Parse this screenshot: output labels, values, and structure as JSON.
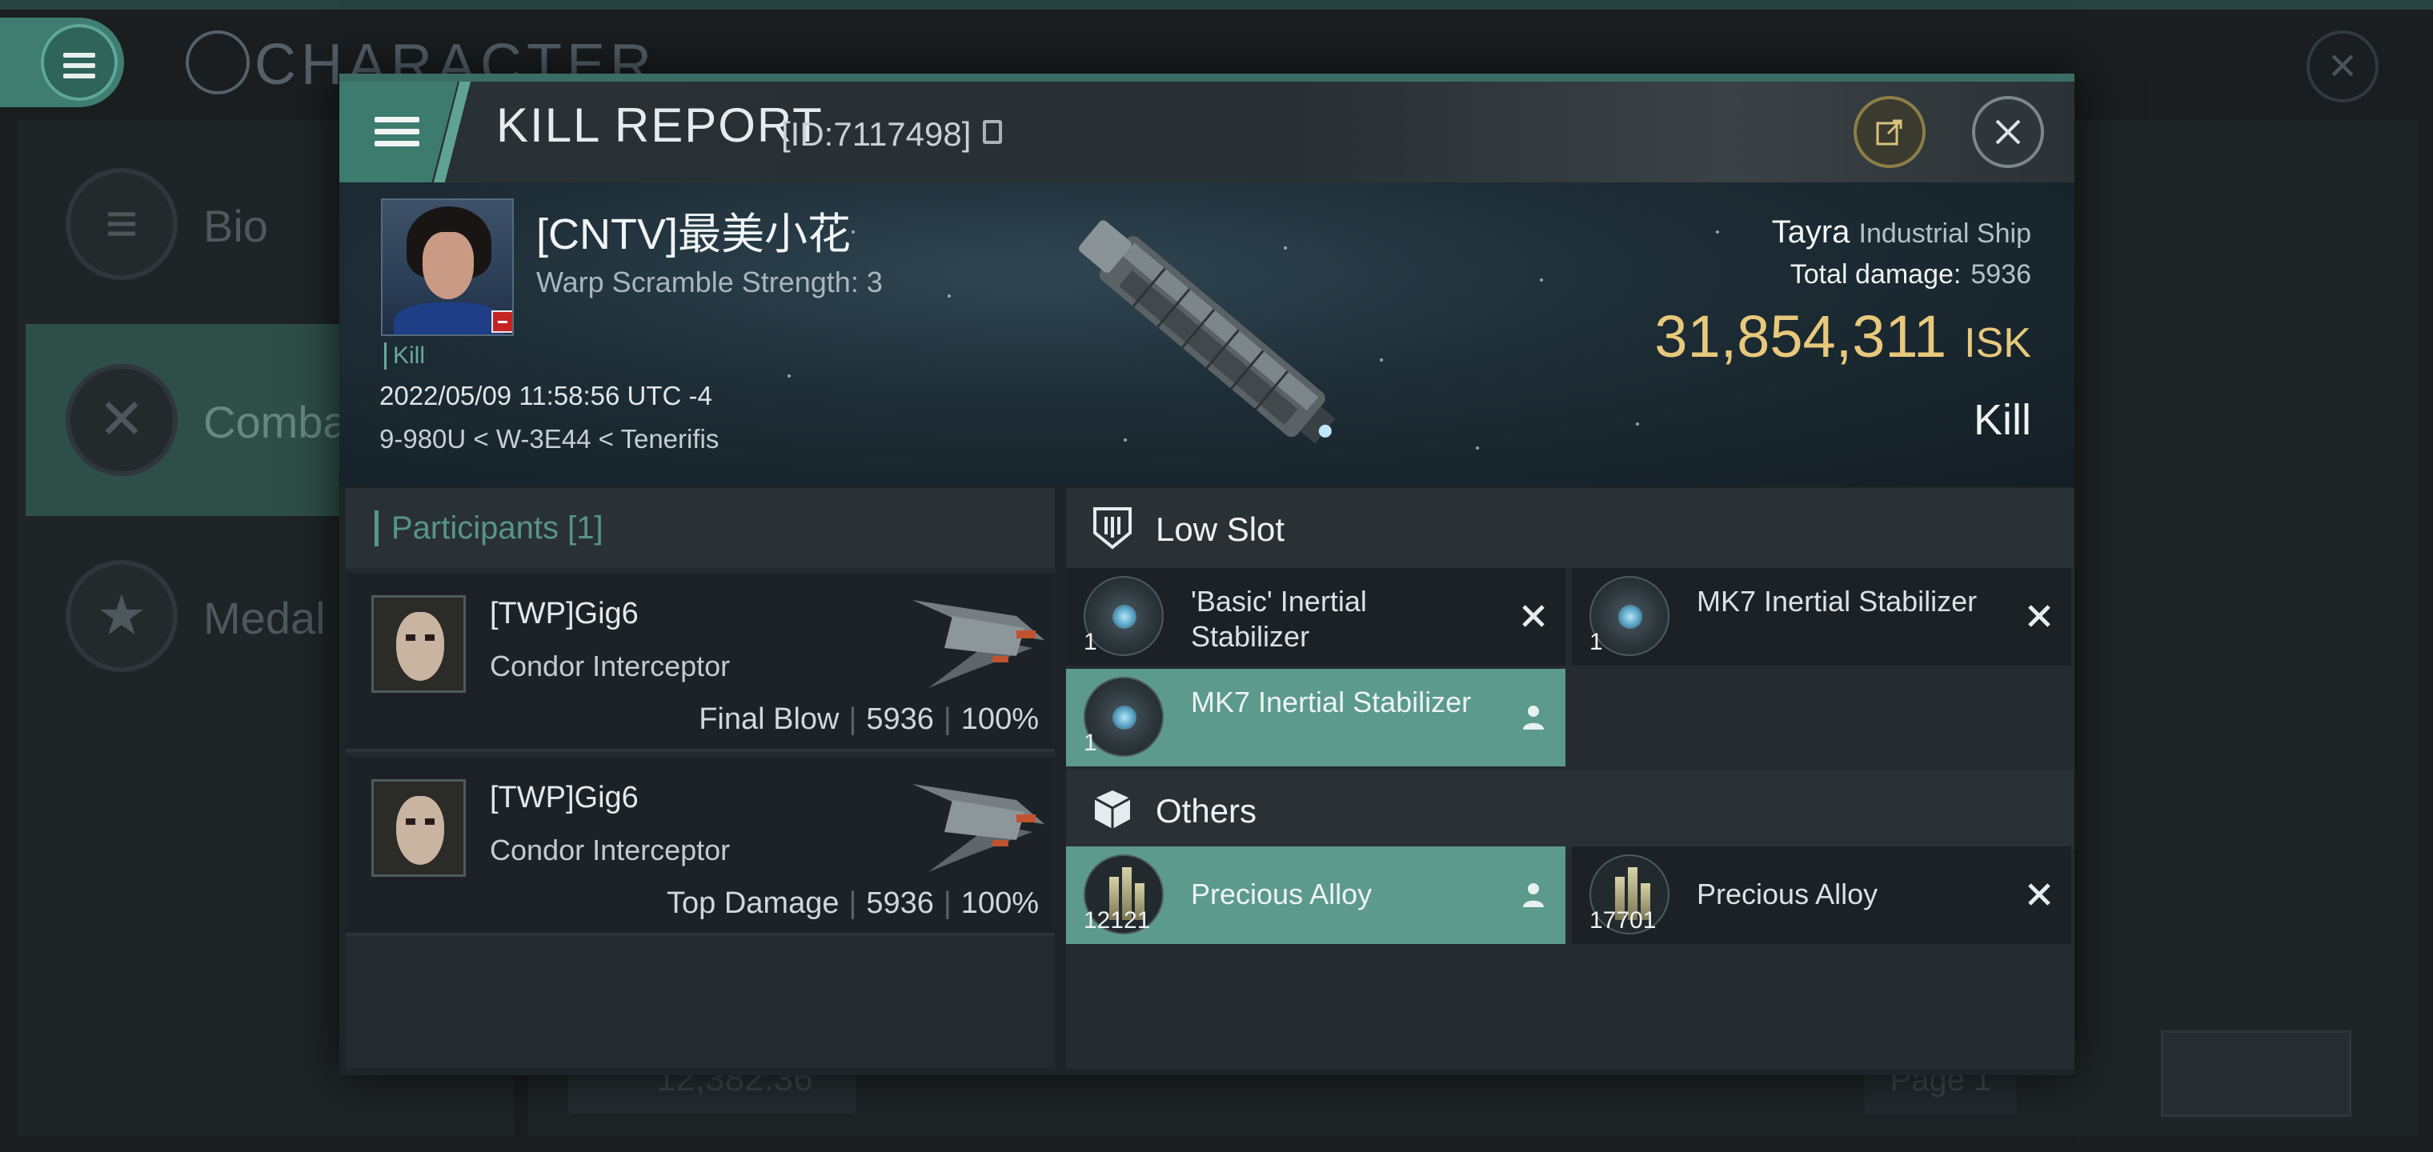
{
  "background": {
    "title": "CHARACTER",
    "tabs": [
      {
        "label": "Bio",
        "icon": "list-icon"
      },
      {
        "label": "Comba",
        "icon": "crossed-swords-icon"
      },
      {
        "label": "Medal",
        "icon": "star-badge-icon"
      }
    ],
    "bottom_value": "12,382.36",
    "page_label": "Page 1"
  },
  "dialog": {
    "title": "KILL REPORT",
    "id_label": "[ID:7117498]",
    "victim": {
      "name": "[CNTV]最美小花",
      "scram": "Warp Scramble Strength: 3",
      "tag": "Kill",
      "datetime": "2022/05/09 11:58:56 UTC -4",
      "location": "9-980U < W-3E44 < Tenerifis"
    },
    "ship": {
      "name": "Tayra",
      "class": "Industrial Ship",
      "total_damage_label": "Total damage:",
      "total_damage": "5936",
      "isk_value": "31,854,311",
      "isk_unit": "ISK",
      "result": "Kill"
    },
    "participants": {
      "header": "Participants [1]",
      "rows": [
        {
          "name": "[TWP]Gig6",
          "ship": "Condor Interceptor",
          "role": "Final Blow",
          "damage": "5936",
          "percent": "100%"
        },
        {
          "name": "[TWP]Gig6",
          "ship": "Condor Interceptor",
          "role": "Top Damage",
          "damage": "5936",
          "percent": "100%"
        }
      ]
    },
    "low_slot": {
      "header": "Low Slot",
      "items": [
        {
          "name": "'Basic' Inertial Stabilizer",
          "qty": "1",
          "status": "destroyed"
        },
        {
          "name": "MK7 Inertial Stabilizer",
          "qty": "1",
          "status": "destroyed"
        },
        {
          "name": "MK7 Inertial Stabilizer",
          "qty": "1",
          "status": "dropped"
        }
      ]
    },
    "others": {
      "header": "Others",
      "items": [
        {
          "name": "Precious Alloy",
          "qty": "12121",
          "status": "dropped"
        },
        {
          "name": "Precious Alloy",
          "qty": "17701",
          "status": "destroyed"
        }
      ]
    }
  },
  "colors": {
    "accent": "#3c7b6e",
    "isk": "#e8c97b",
    "dropped_bg": "#5c9a8c"
  }
}
